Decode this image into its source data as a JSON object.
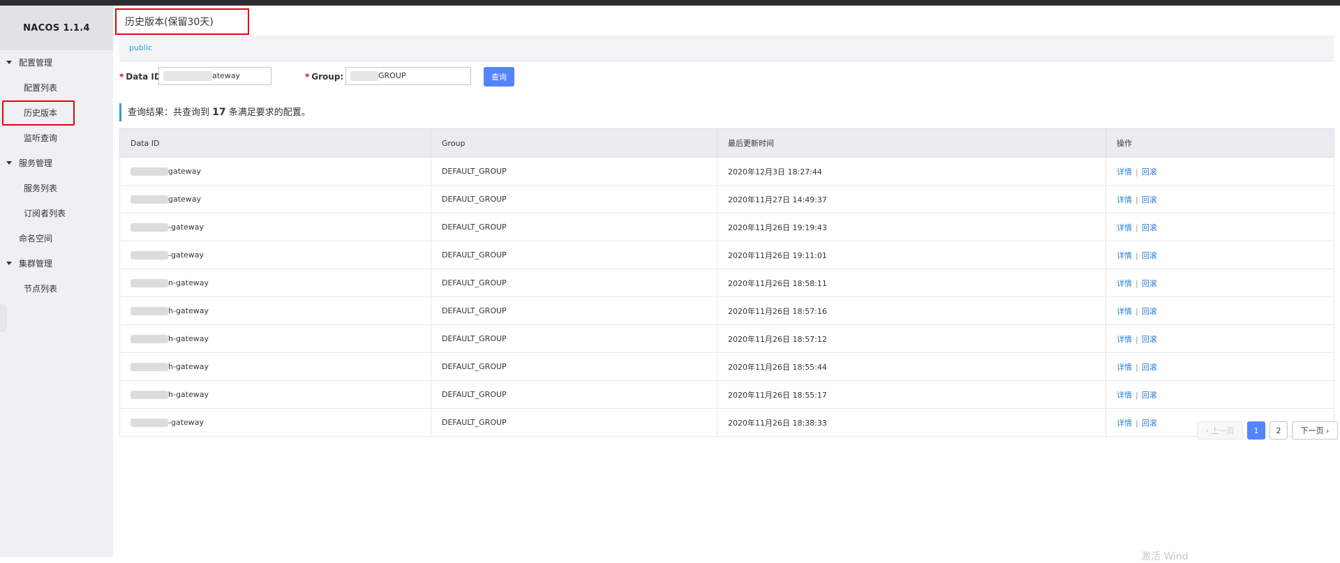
{
  "app": {
    "brand": "NACOS 1.1.4"
  },
  "sidebar": {
    "items": [
      {
        "label": "配置管理",
        "type": "group"
      },
      {
        "label": "配置列表",
        "type": "sub"
      },
      {
        "label": "历史版本",
        "type": "sub",
        "active": true
      },
      {
        "label": "监听查询",
        "type": "sub"
      },
      {
        "label": "服务管理",
        "type": "group"
      },
      {
        "label": "服务列表",
        "type": "sub"
      },
      {
        "label": "订阅者列表",
        "type": "sub"
      },
      {
        "label": "命名空间",
        "type": "plain"
      },
      {
        "label": "集群管理",
        "type": "group"
      },
      {
        "label": "节点列表",
        "type": "sub"
      }
    ]
  },
  "page": {
    "title": "历史版本(保留30天)"
  },
  "namespace": {
    "tab": "public"
  },
  "search": {
    "dataid_label": "Data ID",
    "dataid_value": "ateway",
    "group_label": "Group:",
    "group_value": "GROUP",
    "button": "查询"
  },
  "result": {
    "prefix": "查询结果：共查询到",
    "count": "17",
    "suffix": "条满足要求的配置。"
  },
  "table": {
    "headers": [
      "Data ID",
      "Group",
      "最后更新时间",
      "操作"
    ],
    "rows": [
      {
        "dataid": "gateway",
        "group": "DEFAULT_GROUP",
        "time": "2020年12月3日 18:27:44"
      },
      {
        "dataid": "gateway",
        "group": "DEFAULT_GROUP",
        "time": "2020年11月27日 14:49:37"
      },
      {
        "dataid": "-gateway",
        "group": "DEFAULT_GROUP",
        "time": "2020年11月26日 19:19:43"
      },
      {
        "dataid": "-gateway",
        "group": "DEFAULT_GROUP",
        "time": "2020年11月26日 19:11:01"
      },
      {
        "dataid": "n-gateway",
        "group": "DEFAULT_GROUP",
        "time": "2020年11月26日 18:58:11"
      },
      {
        "dataid": "h-gateway",
        "group": "DEFAULT_GROUP",
        "time": "2020年11月26日 18:57:16"
      },
      {
        "dataid": "h-gateway",
        "group": "DEFAULT_GROUP",
        "time": "2020年11月26日 18:57:12"
      },
      {
        "dataid": "h-gateway",
        "group": "DEFAULT_GROUP",
        "time": "2020年11月26日 18:55:44"
      },
      {
        "dataid": "h-gateway",
        "group": "DEFAULT_GROUP",
        "time": "2020年11月26日 18:55:17"
      },
      {
        "dataid": "-gateway",
        "group": "DEFAULT_GROUP",
        "time": "2020年11月26日 18:38:33"
      }
    ],
    "op_detail": "详情",
    "op_separator": "|",
    "op_rollback": "回滚"
  },
  "pagination": {
    "prev": "上一页",
    "pages": [
      "1",
      "2"
    ],
    "current": "1",
    "next": "下一页"
  },
  "watermark": "激活 Wind",
  "colors": {
    "primary": "#5584ff",
    "link": "#2a7ccc",
    "highlight_box": "#e60012",
    "tab_accent": "#2a9fd8"
  }
}
